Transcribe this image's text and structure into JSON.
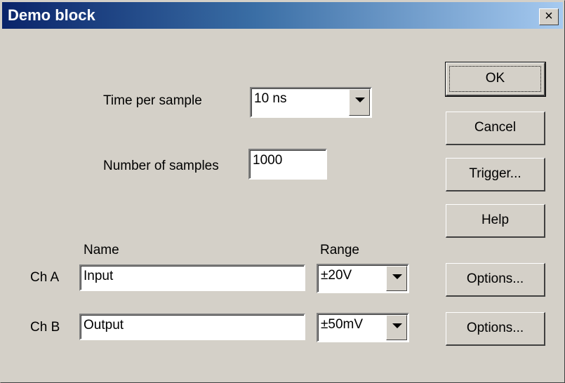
{
  "window": {
    "title": "Demo block"
  },
  "form": {
    "time_per_sample_label": "Time per sample",
    "time_per_sample_value": "10 ns",
    "num_samples_label": "Number of samples",
    "num_samples_value": "1000",
    "name_header": "Name",
    "range_header": "Range"
  },
  "channels": [
    {
      "label": "Ch A",
      "name": "Input",
      "range": "±20V"
    },
    {
      "label": "Ch B",
      "name": "Output",
      "range": "±50mV"
    }
  ],
  "buttons": {
    "ok": "OK",
    "cancel": "Cancel",
    "trigger": "Trigger...",
    "help": "Help",
    "options": "Options..."
  }
}
